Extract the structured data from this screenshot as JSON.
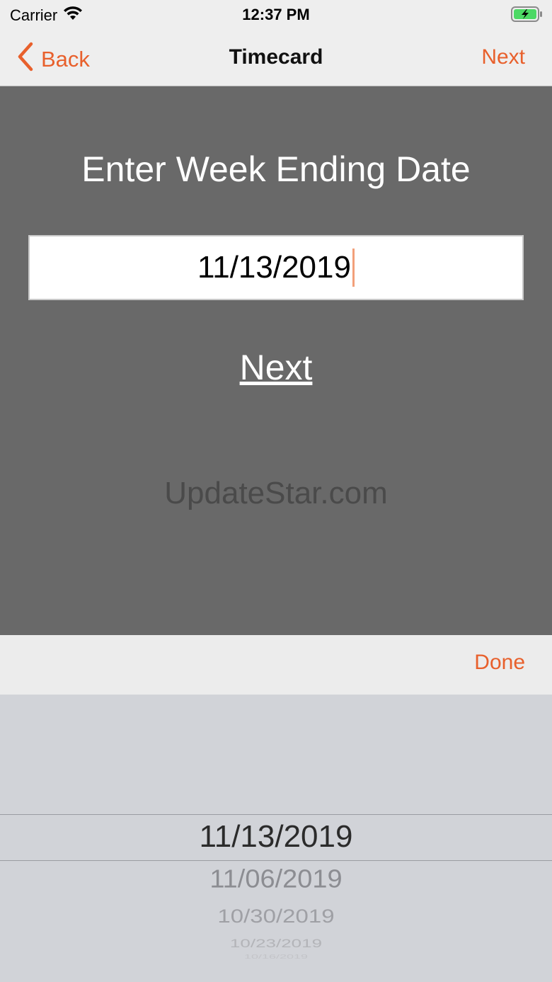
{
  "status_bar": {
    "carrier": "Carrier",
    "time": "12:37 PM",
    "wifi_icon": "wifi-icon",
    "battery_icon": "battery-charging-icon"
  },
  "nav": {
    "back_label": "Back",
    "title": "Timecard",
    "next_label": "Next"
  },
  "main": {
    "heading": "Enter Week Ending Date",
    "date_value": "11/13/2019",
    "next_link": "Next",
    "watermark": "UpdateStar.com"
  },
  "toolbar": {
    "done_label": "Done"
  },
  "picker": {
    "options": [
      "11/13/2019",
      "11/06/2019",
      "10/30/2019",
      "10/23/2019",
      "10/16/2019"
    ],
    "selected": "11/13/2019"
  },
  "colors": {
    "accent": "#e8602c",
    "content_bg": "#696969",
    "bar_bg": "#eeeeee",
    "picker_bg": "#d1d3d8"
  }
}
